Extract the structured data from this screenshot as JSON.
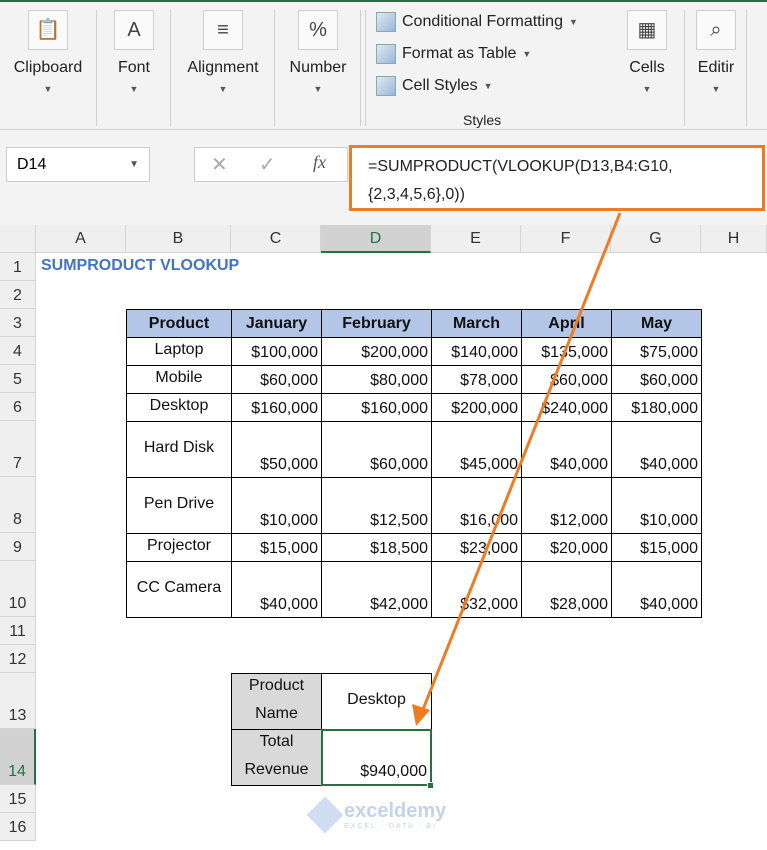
{
  "ribbon": {
    "groups": [
      {
        "label": "Clipboard",
        "icon": "clipboard-icon"
      },
      {
        "label": "Font",
        "icon": "font-icon"
      },
      {
        "label": "Alignment",
        "icon": "align-icon"
      },
      {
        "label": "Number",
        "icon": "percent-icon"
      },
      {
        "label": "Cells",
        "icon": "cells-icon"
      },
      {
        "label": "Editir",
        "icon": "search-icon"
      }
    ],
    "styles": {
      "label": "Styles",
      "items": [
        "Conditional Formatting",
        "Format as Table",
        "Cell Styles"
      ]
    }
  },
  "formula_bar": {
    "name_box": "D14",
    "fx": "fx",
    "formula": "=SUMPRODUCT(VLOOKUP(D13,B4:G10,{2,3,4,5,6},0))"
  },
  "columns": [
    "A",
    "B",
    "C",
    "D",
    "E",
    "F",
    "G",
    "H"
  ],
  "rows": [
    "1",
    "2",
    "3",
    "4",
    "5",
    "6",
    "7",
    "8",
    "9",
    "10",
    "11",
    "12",
    "13",
    "14",
    "15",
    "16"
  ],
  "sheet": {
    "title": "SUMPRODUCT VLOOKUP",
    "table": {
      "headers": [
        "Product",
        "January",
        "February",
        "March",
        "April",
        "May"
      ],
      "rows": [
        [
          "Laptop",
          "$100,000",
          "$200,000",
          "$140,000",
          "$135,000",
          "$75,000"
        ],
        [
          "Mobile",
          "$60,000",
          "$80,000",
          "$78,000",
          "$60,000",
          "$60,000"
        ],
        [
          "Desktop",
          "$160,000",
          "$160,000",
          "$200,000",
          "$240,000",
          "$180,000"
        ],
        [
          "Hard Disk",
          "$50,000",
          "$60,000",
          "$45,000",
          "$40,000",
          "$40,000"
        ],
        [
          "Pen Drive",
          "$10,000",
          "$12,500",
          "$16,000",
          "$12,000",
          "$10,000"
        ],
        [
          "Projector",
          "$15,000",
          "$18,500",
          "$23,000",
          "$20,000",
          "$15,000"
        ],
        [
          "CC Camera",
          "$40,000",
          "$42,000",
          "$32,000",
          "$28,000",
          "$40,000"
        ]
      ]
    },
    "lookup": {
      "product_label": "Product Name",
      "product_value": "Desktop",
      "total_label": "Total Revenue",
      "total_value": "$940,000"
    }
  },
  "watermark": {
    "brand": "exceldemy",
    "tagline": "EXCEL · DATA · BI"
  },
  "colors": {
    "accent": "#f07c22",
    "header_fill": "#b4c6e7",
    "selection": "#217346"
  }
}
